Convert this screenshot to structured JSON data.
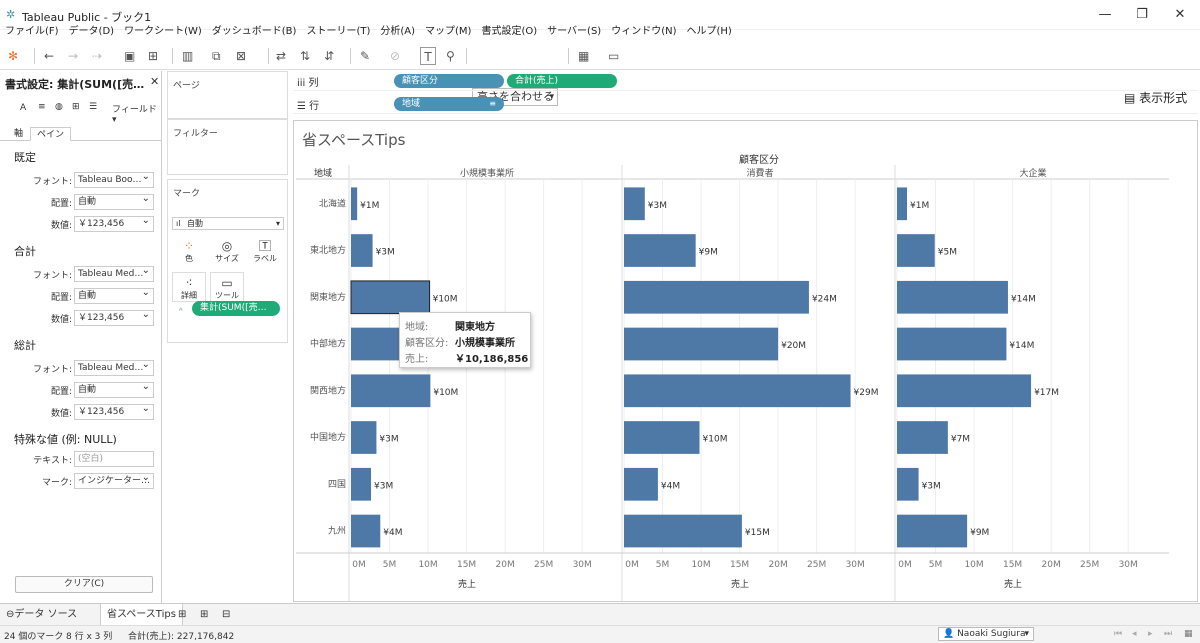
{
  "window": {
    "title": "Tableau Public - ブック1"
  },
  "menu": [
    "ファイル(F)",
    "データ(D)",
    "ワークシート(W)",
    "ダッシュボード(B)",
    "ストーリー(T)",
    "分析(A)",
    "マップ(M)",
    "書式設定(O)",
    "サーバー(S)",
    "ウィンドウ(N)",
    "ヘルプ(H)"
  ],
  "toolbar": {
    "fit_label": "高さを合わせる",
    "show_me_label": "表示形式"
  },
  "format_pane": {
    "title": "書式設定: 集計(SUM([売…",
    "field_label": "フィールド",
    "tabs": [
      "軸",
      "ペイン"
    ],
    "sections": [
      {
        "name": "既定",
        "font": "Tableau Boo…",
        "align": "自動",
        "number": "￥123,456"
      },
      {
        "name": "合計",
        "font": "Tableau Med…",
        "align": "自動",
        "number": "￥123,456"
      },
      {
        "name": "総計",
        "font": "Tableau Med…",
        "align": "自動",
        "number": "￥123,456"
      }
    ],
    "row_labels": {
      "font": "フォント:",
      "align": "配置:",
      "number": "数値:"
    },
    "special": {
      "name": "特殊な値 (例: NULL)",
      "text_label": "テキスト:",
      "text_placeholder": "(空白)",
      "mark_label": "マーク:",
      "mark_value": "インジケーター…"
    },
    "clear_label": "クリア(C)"
  },
  "cards": {
    "pages": "ページ",
    "filters": "フィルター",
    "marks": "マーク",
    "mark_type": "自動",
    "buttons": {
      "color": "色",
      "size": "サイズ",
      "label": "ラベル",
      "detail": "詳細",
      "tooltip": "ツールヒ…"
    },
    "pill": "集計(SUM([売…"
  },
  "shelves": {
    "columns_label": "列",
    "rows_label": "行",
    "columns_pills": [
      "顧客区分",
      "合計(売上)"
    ],
    "rows_pills": [
      "地域"
    ]
  },
  "view": {
    "title": "省スペースTips"
  },
  "chart_data": {
    "type": "bar",
    "orientation": "horizontal",
    "header_title": "顧客区分",
    "row_header": "地域",
    "categories": [
      "北海道",
      "東北地方",
      "関東地方",
      "中部地方",
      "関西地方",
      "中国地方",
      "四国",
      "九州"
    ],
    "series": [
      {
        "name": "小規模事業所",
        "values": [
          0.8,
          2.8,
          10.2,
          10.5,
          10.3,
          3.3,
          2.6,
          3.8
        ],
        "labels": [
          "¥1M",
          "¥3M",
          "¥10M",
          "",
          "¥10M",
          "¥3M",
          "¥3M",
          "¥4M"
        ]
      },
      {
        "name": "消費者",
        "values": [
          2.7,
          9.3,
          24.0,
          20.0,
          29.4,
          9.8,
          4.4,
          15.3
        ],
        "labels": [
          "¥3M",
          "¥9M",
          "¥24M",
          "¥20M",
          "¥29M",
          "¥10M",
          "¥4M",
          "¥15M"
        ]
      },
      {
        "name": "大企業",
        "values": [
          1.3,
          4.9,
          14.4,
          14.2,
          17.4,
          6.6,
          2.8,
          9.1
        ],
        "labels": [
          "¥1M",
          "¥5M",
          "¥14M",
          "¥14M",
          "¥17M",
          "¥7M",
          "¥3M",
          "¥9M"
        ]
      }
    ],
    "xlim": [
      0,
      34
    ],
    "xticks": [
      "0M",
      "5M",
      "10M",
      "15M",
      "20M",
      "25M",
      "30M"
    ],
    "xlabel": "売上",
    "bar_color": "#4e79a7",
    "grid": true
  },
  "tooltip": {
    "rows": [
      {
        "k": "地域:",
        "v": "関東地方"
      },
      {
        "k": "顧客区分:",
        "v": "小規模事業所"
      },
      {
        "k": "売上:",
        "v": "￥10,186,856"
      }
    ]
  },
  "bottom_tabs": {
    "datasource": "データ ソース",
    "sheet": "省スペースTips"
  },
  "status": {
    "marks": "24 個のマーク",
    "dims": "8 行 x 3 列",
    "sum": "合計(売上): 227,176,842",
    "user": "Naoaki Sugiura"
  }
}
